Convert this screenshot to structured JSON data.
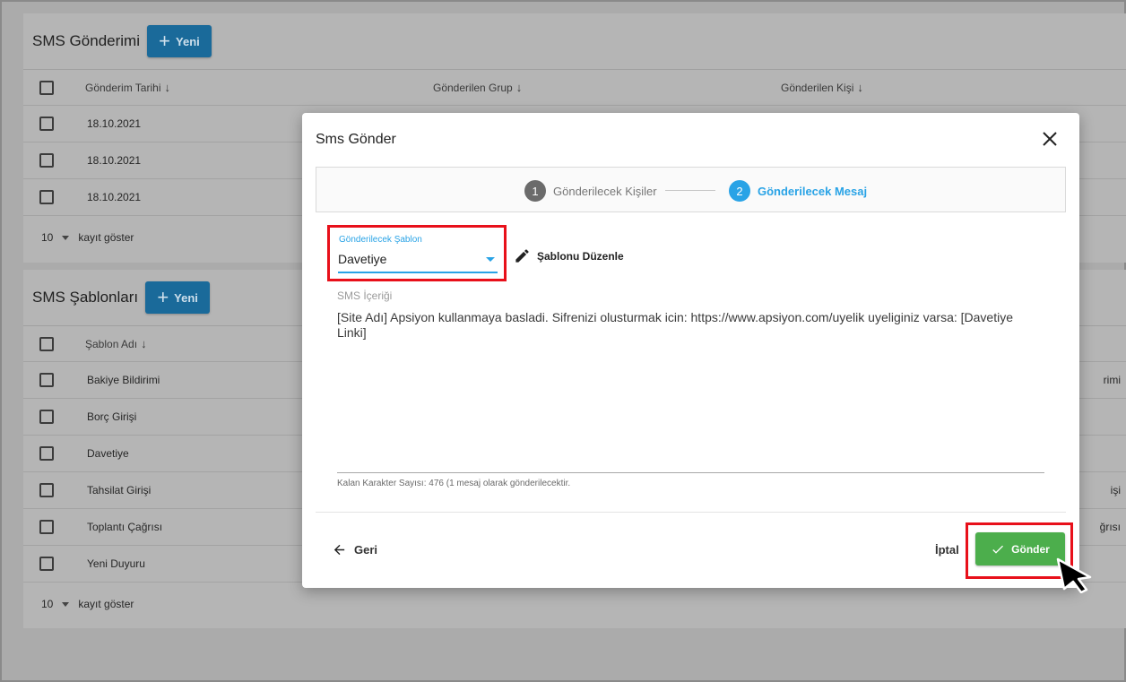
{
  "sms_sending": {
    "title": "SMS Gönderimi",
    "new_label": "Yeni",
    "columns": [
      "Gönderim Tarihi",
      "Gönderilen Grup",
      "Gönderilen Kişi"
    ],
    "rows": [
      "18.10.2021",
      "18.10.2021",
      "18.10.2021"
    ],
    "page_size": "10",
    "page_size_label": "kayıt göster"
  },
  "sms_templates": {
    "title": "SMS Şablonları",
    "new_label": "Yeni",
    "columns": [
      "Şablon Adı"
    ],
    "rows": [
      "Bakiye Bildirimi",
      "Borç Girişi",
      "Davetiye",
      "Tahsilat Girişi",
      "Toplantı Çağrısı",
      "Yeni Duyuru"
    ],
    "edge_fragments": [
      "rimi",
      "işi",
      "ğrısı"
    ],
    "page_size": "10",
    "page_size_label": "kayıt göster"
  },
  "modal": {
    "title": "Sms Gönder",
    "steps": [
      {
        "number": "1",
        "label": "Gönderilecek Kişiler"
      },
      {
        "number": "2",
        "label": "Gönderilecek Mesaj"
      }
    ],
    "template_field": {
      "label": "Gönderilecek Şablon",
      "value": "Davetiye"
    },
    "edit_template_label": "Şablonu Düzenle",
    "content_label": "SMS İçeriği",
    "content_text": "[Site Adı] Apsiyon kullanmaya basladi. Sifrenizi olusturmak icin: https://www.apsiyon.com/uyelik uyeliginiz varsa: [Davetiye Linki]",
    "char_hint": "Kalan Karakter Sayısı: 476 (1 mesaj olarak gönderilecektir.",
    "back_label": "Geri",
    "cancel_label": "İptal",
    "send_label": "Gönder"
  },
  "colors": {
    "accent": "#29a3e6",
    "highlight": "#e8101a",
    "send": "#4cae4c"
  }
}
